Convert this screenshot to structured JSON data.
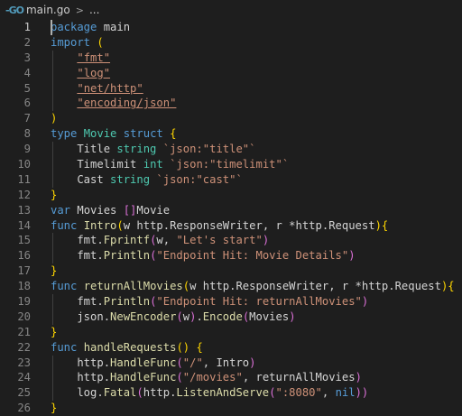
{
  "breadcrumb": {
    "file_icon": "go-file-icon",
    "file_icon_text": "-GO",
    "file": "main.go",
    "separator": ">",
    "more": "..."
  },
  "colors": {
    "background": "#1e1e1e",
    "keyword": "#569cd6",
    "type": "#4ec9b0",
    "function": "#dcdcaa",
    "string": "#ce9178",
    "bracket": "#ffd700",
    "bracket_nested": "#da70d6"
  },
  "lines": [
    {
      "n": "1",
      "tokens": [
        [
          "kw",
          "package"
        ],
        [
          "plain",
          " main"
        ]
      ]
    },
    {
      "n": "2",
      "tokens": [
        [
          "kw",
          "import"
        ],
        [
          "plain",
          " "
        ],
        [
          "par",
          "("
        ]
      ]
    },
    {
      "n": "3",
      "tokens": [
        [
          "plain",
          "    "
        ],
        [
          "imp",
          "\"fmt\""
        ]
      ]
    },
    {
      "n": "4",
      "tokens": [
        [
          "plain",
          "    "
        ],
        [
          "imp",
          "\"log\""
        ]
      ]
    },
    {
      "n": "5",
      "tokens": [
        [
          "plain",
          "    "
        ],
        [
          "imp",
          "\"net/http\""
        ]
      ]
    },
    {
      "n": "6",
      "tokens": [
        [
          "plain",
          "    "
        ],
        [
          "imp",
          "\"encoding/json\""
        ]
      ]
    },
    {
      "n": "7",
      "tokens": [
        [
          "par",
          ")"
        ]
      ]
    },
    {
      "n": "8",
      "tokens": [
        [
          "kw",
          "type"
        ],
        [
          "plain",
          " "
        ],
        [
          "typ",
          "Movie"
        ],
        [
          "plain",
          " "
        ],
        [
          "kw",
          "struct"
        ],
        [
          "plain",
          " "
        ],
        [
          "par",
          "{"
        ]
      ]
    },
    {
      "n": "9",
      "tokens": [
        [
          "plain",
          "    Title "
        ],
        [
          "typ",
          "string"
        ],
        [
          "plain",
          " "
        ],
        [
          "str",
          "`json:\"title\"`"
        ]
      ]
    },
    {
      "n": "10",
      "tokens": [
        [
          "plain",
          "    Timelimit "
        ],
        [
          "typ",
          "int"
        ],
        [
          "plain",
          " "
        ],
        [
          "str",
          "`json:\"timelimit\"`"
        ]
      ]
    },
    {
      "n": "11",
      "tokens": [
        [
          "plain",
          "    Cast "
        ],
        [
          "typ",
          "string"
        ],
        [
          "plain",
          " "
        ],
        [
          "str",
          "`json:\"cast\"`"
        ]
      ]
    },
    {
      "n": "12",
      "tokens": [
        [
          "par",
          "}"
        ]
      ]
    },
    {
      "n": "13",
      "tokens": [
        [
          "kw",
          "var"
        ],
        [
          "plain",
          " Movies "
        ],
        [
          "par2",
          "[]"
        ],
        [
          "plain",
          "Movie"
        ]
      ]
    },
    {
      "n": "14",
      "tokens": [
        [
          "kw",
          "func"
        ],
        [
          "plain",
          " "
        ],
        [
          "fn",
          "Intro"
        ],
        [
          "par",
          "("
        ],
        [
          "plain",
          "w http.ResponseWriter, r *http.Request"
        ],
        [
          "par",
          ")"
        ],
        [
          "par",
          "{"
        ]
      ]
    },
    {
      "n": "15",
      "tokens": [
        [
          "plain",
          "    fmt."
        ],
        [
          "fn",
          "Fprintf"
        ],
        [
          "par2",
          "("
        ],
        [
          "plain",
          "w, "
        ],
        [
          "str",
          "\"Let's start\""
        ],
        [
          "par2",
          ")"
        ]
      ]
    },
    {
      "n": "16",
      "tokens": [
        [
          "plain",
          "    fmt."
        ],
        [
          "fn",
          "Println"
        ],
        [
          "par2",
          "("
        ],
        [
          "str",
          "\"Endpoint Hit: Movie Details\""
        ],
        [
          "par2",
          ")"
        ]
      ]
    },
    {
      "n": "17",
      "tokens": [
        [
          "par",
          "}"
        ]
      ]
    },
    {
      "n": "18",
      "tokens": [
        [
          "kw",
          "func"
        ],
        [
          "plain",
          " "
        ],
        [
          "fn",
          "returnAllMovies"
        ],
        [
          "par",
          "("
        ],
        [
          "plain",
          "w http.ResponseWriter, r *http.Request"
        ],
        [
          "par",
          ")"
        ],
        [
          "par",
          "{"
        ]
      ]
    },
    {
      "n": "19",
      "tokens": [
        [
          "plain",
          "    fmt."
        ],
        [
          "fn",
          "Println"
        ],
        [
          "par2",
          "("
        ],
        [
          "str",
          "\"Endpoint Hit: returnAllMovies\""
        ],
        [
          "par2",
          ")"
        ]
      ]
    },
    {
      "n": "20",
      "tokens": [
        [
          "plain",
          "    json."
        ],
        [
          "fn",
          "NewEncoder"
        ],
        [
          "par2",
          "("
        ],
        [
          "plain",
          "w"
        ],
        [
          "par2",
          ")"
        ],
        [
          "plain",
          "."
        ],
        [
          "fn",
          "Encode"
        ],
        [
          "par2",
          "("
        ],
        [
          "plain",
          "Movies"
        ],
        [
          "par2",
          ")"
        ]
      ]
    },
    {
      "n": "21",
      "tokens": [
        [
          "par",
          "}"
        ]
      ]
    },
    {
      "n": "22",
      "tokens": [
        [
          "kw",
          "func"
        ],
        [
          "plain",
          " "
        ],
        [
          "fn",
          "handleRequests"
        ],
        [
          "par",
          "()"
        ],
        [
          "plain",
          " "
        ],
        [
          "par",
          "{"
        ]
      ]
    },
    {
      "n": "23",
      "tokens": [
        [
          "plain",
          "    http."
        ],
        [
          "fn",
          "HandleFunc"
        ],
        [
          "par2",
          "("
        ],
        [
          "str",
          "\"/\""
        ],
        [
          "plain",
          ", Intro"
        ],
        [
          "par2",
          ")"
        ]
      ]
    },
    {
      "n": "24",
      "tokens": [
        [
          "plain",
          "    http."
        ],
        [
          "fn",
          "HandleFunc"
        ],
        [
          "par2",
          "("
        ],
        [
          "str",
          "\"/movies\""
        ],
        [
          "plain",
          ", returnAllMovies"
        ],
        [
          "par2",
          ")"
        ]
      ]
    },
    {
      "n": "25",
      "tokens": [
        [
          "plain",
          "    log."
        ],
        [
          "fn",
          "Fatal"
        ],
        [
          "par2",
          "("
        ],
        [
          "plain",
          "http."
        ],
        [
          "fn",
          "ListenAndServe"
        ],
        [
          "par2",
          "("
        ],
        [
          "str",
          "\":8080\""
        ],
        [
          "plain",
          ", "
        ],
        [
          "kw",
          "nil"
        ],
        [
          "par2",
          "))"
        ]
      ]
    },
    {
      "n": "26",
      "tokens": [
        [
          "par",
          "}"
        ]
      ]
    }
  ]
}
